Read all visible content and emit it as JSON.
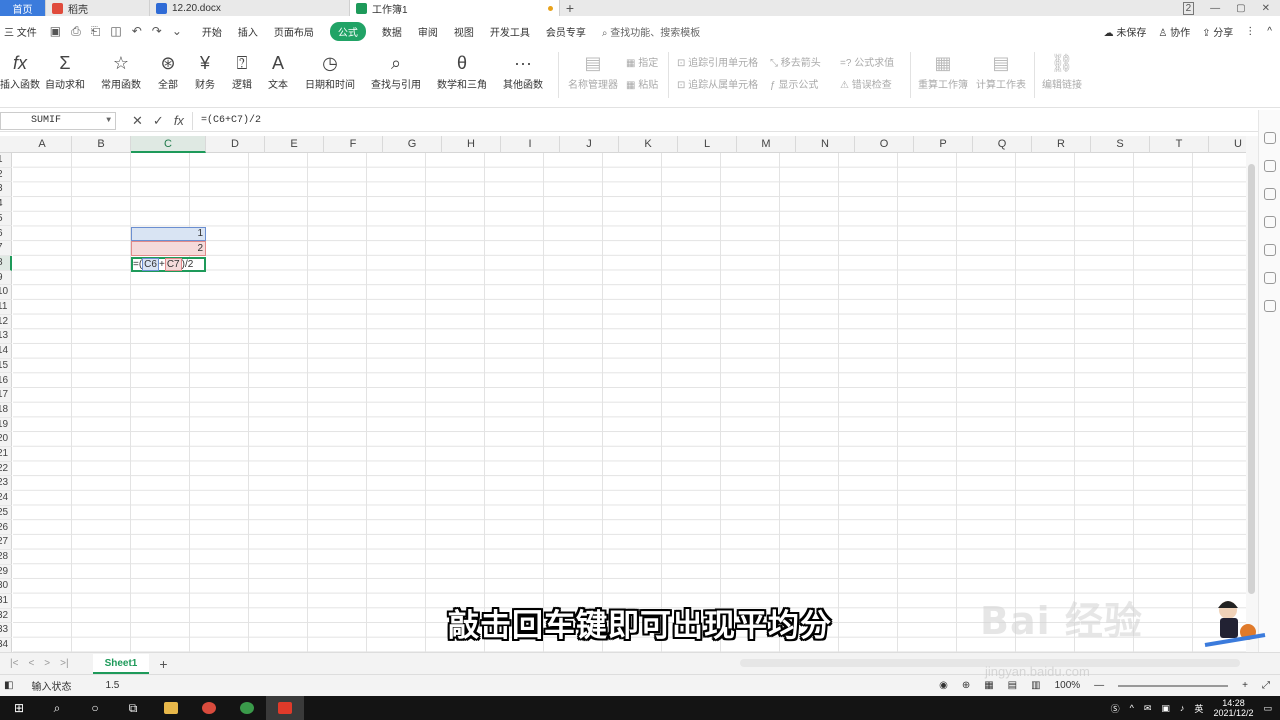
{
  "tabs": [
    {
      "label": "首页"
    },
    {
      "label": "稻壳"
    },
    {
      "label": "12.20.docx"
    },
    {
      "label": "工作簿1"
    }
  ],
  "window": {
    "badge": "2"
  },
  "menu": {
    "file": "三 文件",
    "items": [
      "开始",
      "插入",
      "页面布局",
      "公式",
      "数据",
      "审阅",
      "视图",
      "开发工具",
      "会员专享"
    ],
    "search": "查找功能、搜索模板",
    "unsaved": "未保存",
    "collab": "协作",
    "share": "分享"
  },
  "ribbon": {
    "insert_func": "插入函数",
    "autosum": "自动求和",
    "common": "常用函数",
    "all": "全部",
    "finance": "财务",
    "logic": "逻辑",
    "text": "文本",
    "datetime": "日期和时间",
    "lookup": "查找与引用",
    "math": "数学和三角",
    "other": "其他函数",
    "name_mgr": "名称管理器",
    "specify": "指定",
    "paste": "粘贴",
    "trace_prec": "追踪引用单元格",
    "trace_dep": "追踪从属单元格",
    "remove_arrows": "移去箭头",
    "show_formula": "显示公式",
    "eval_formula": "公式求值",
    "error_check": "错误检查",
    "recalc_wb": "重算工作簿",
    "calc_sheet": "计算工作表",
    "edit_links": "编辑链接"
  },
  "formula_bar": {
    "name_box": "SUMIF",
    "formula": "=(C6+C7)/2"
  },
  "columns": [
    "A",
    "B",
    "C",
    "D",
    "E",
    "F",
    "G",
    "H",
    "I",
    "J",
    "K",
    "L",
    "M",
    "N",
    "O",
    "P",
    "Q",
    "R",
    "S",
    "T",
    "U"
  ],
  "rows": [
    "1",
    "2",
    "3",
    "4",
    "5",
    "6",
    "7",
    "8",
    "9",
    "10",
    "11",
    "12",
    "13",
    "14",
    "15",
    "16",
    "17",
    "18",
    "19",
    "20",
    "21",
    "22",
    "23",
    "24",
    "25",
    "26",
    "27",
    "28",
    "29",
    "30",
    "31",
    "32",
    "33",
    "34"
  ],
  "cells": {
    "c6": "1",
    "c7": "2",
    "c8": {
      "pre": "=(",
      "ref1": "C6",
      "plus": "+",
      "ref2": "C7",
      "post": ")/2"
    }
  },
  "sheet": {
    "name": "Sheet1"
  },
  "status": {
    "mode": "输入状态",
    "value": "1.5",
    "zoom": "100%"
  },
  "taskbar": {
    "time": "14:28",
    "date": "2021/12/2"
  },
  "subtitle": "敲击回车键即可出现平均分",
  "watermark": {
    "main": "Bai 经验",
    "sub": "jingyan.baidu.com"
  }
}
